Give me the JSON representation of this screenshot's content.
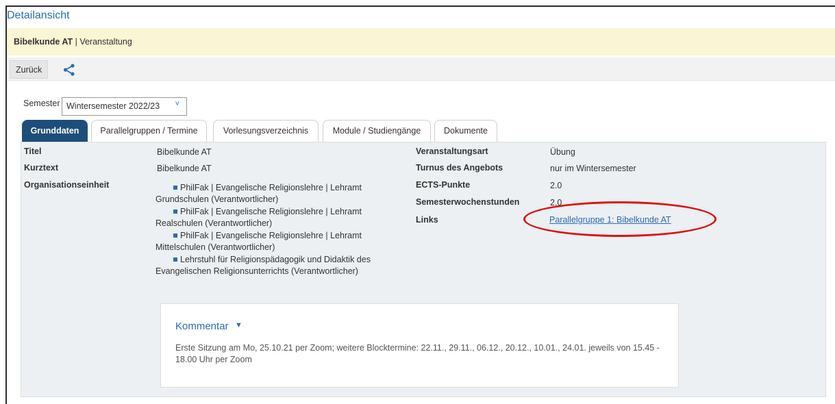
{
  "page_title": "Detailansicht",
  "title_bar": {
    "name": "Bibelkunde AT",
    "separator": " | ",
    "type": "Veranstaltung"
  },
  "toolbar": {
    "back_label": "Zurück",
    "share_icon": "share-icon"
  },
  "semester": {
    "label": "Semester",
    "selected": "Wintersemester 2022/23"
  },
  "tabs": [
    {
      "label": "Grunddaten",
      "active": true
    },
    {
      "label": "Parallelgruppen / Termine",
      "active": false
    },
    {
      "label": "Vorlesungsverzeichnis",
      "active": false
    },
    {
      "label": "Module / Studiengänge",
      "active": false
    },
    {
      "label": "Dokumente",
      "active": false
    }
  ],
  "details": {
    "titel_label": "Titel",
    "titel_value": "Bibelkunde AT",
    "kurztext_label": "Kurztext",
    "kurztext_value": "Bibelkunde AT",
    "org_label": "Organisationseinheit",
    "org_items": [
      "PhilFak | Evangelische Religionslehre | Lehramt Grundschulen (Verantwortlicher)",
      "PhilFak | Evangelische Religionslehre | Lehramt Realschulen (Verantwortlicher)",
      "PhilFak | Evangelische Religionslehre | Lehramt Mittelschulen (Verantwortlicher)",
      "Lehrstuhl für Religionspädagogik und Didaktik des Evangelischen Religionsunterrichts (Verantwortlicher)"
    ],
    "art_label": "Veranstaltungsart",
    "art_value": "Übung",
    "turnus_label": "Turnus des Angebots",
    "turnus_value": "nur im Wintersemester",
    "ects_label": "ECTS-Punkte",
    "ects_value": "2.0",
    "sws_label": "Semesterwochenstunden",
    "sws_value": "2.0",
    "links_label": "Links",
    "links_value": "Parallelgruppe 1: Bibelkunde AT"
  },
  "comment": {
    "title": "Kommentar",
    "text": "Erste Sitzung am Mo, 25.10.21 per Zoom; weitere Blocktermine: 22.11., 29.11., 06.12., 20.12., 10.01., 24.01. jeweils von 15.45 - 18.00 Uhr per Zoom"
  },
  "colors": {
    "accent": "#2b6cb0",
    "active_tab": "#1d4e79",
    "title_bar_bg": "#faf5d4",
    "highlight": "#e01010"
  }
}
